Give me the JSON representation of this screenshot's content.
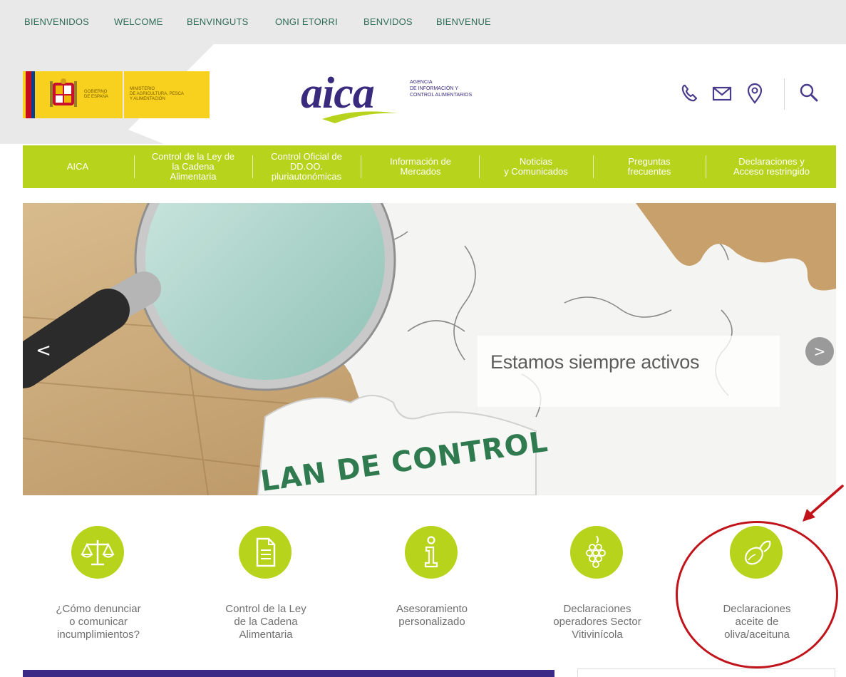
{
  "languages": [
    "BIENVENIDOS",
    "WELCOME",
    "BENVINGUTS",
    "ONGI ETORRI",
    "BENVIDOS",
    "BIENVENUE"
  ],
  "government_logo": {
    "left_text": "GOBIERNO\nDE ESPAÑA",
    "right_text": "MINISTERIO\nDE AGRICULTURA, PESCA\nY ALIMENTACIÓN"
  },
  "brand": {
    "name": "aica",
    "subtitle": "AGENCIA\nDE INFORMACIÓN Y\nCONTROL ALIMENTARIOS"
  },
  "header_icons": [
    "phone-icon",
    "mail-icon",
    "location-icon",
    "search-icon"
  ],
  "nav": {
    "items": [
      {
        "label": "AICA"
      },
      {
        "label": "Control de la Ley de\nla Cadena\nAlimentaria"
      },
      {
        "label": "Control Oficial de\nDD.OO.\npluriautonómicas"
      },
      {
        "label": "Información de\nMercados"
      },
      {
        "label": "Noticias\ny Comunicados"
      },
      {
        "label": "Preguntas\nfrecuentes"
      },
      {
        "label": "Declaraciones y\nAcceso restringido"
      }
    ]
  },
  "hero": {
    "caption": "Estamos siempre activos",
    "puzzle_text": "LAN DE CONTROL",
    "prev_symbol": "<",
    "next_symbol": ">"
  },
  "quick_links": [
    {
      "label": "¿Cómo denunciar\no comunicar\nincumplimientos?",
      "icon": "scales-icon"
    },
    {
      "label": "Control de la Ley\nde la Cadena\nAlimentaria",
      "icon": "document-icon"
    },
    {
      "label": "Asesoramiento\npersonalizado",
      "icon": "info-icon"
    },
    {
      "label": "Declaraciones\noperadores Sector\nVitivinícola",
      "icon": "grapes-icon"
    },
    {
      "label": "Declaraciones\naceite de\noliva/aceituna",
      "icon": "olive-icon"
    }
  ],
  "colors": {
    "accent": "#b8d31b",
    "brand_purple": "#3a2a7e",
    "gov_yellow": "#f7d11d",
    "highlight_red": "#c0141a"
  }
}
